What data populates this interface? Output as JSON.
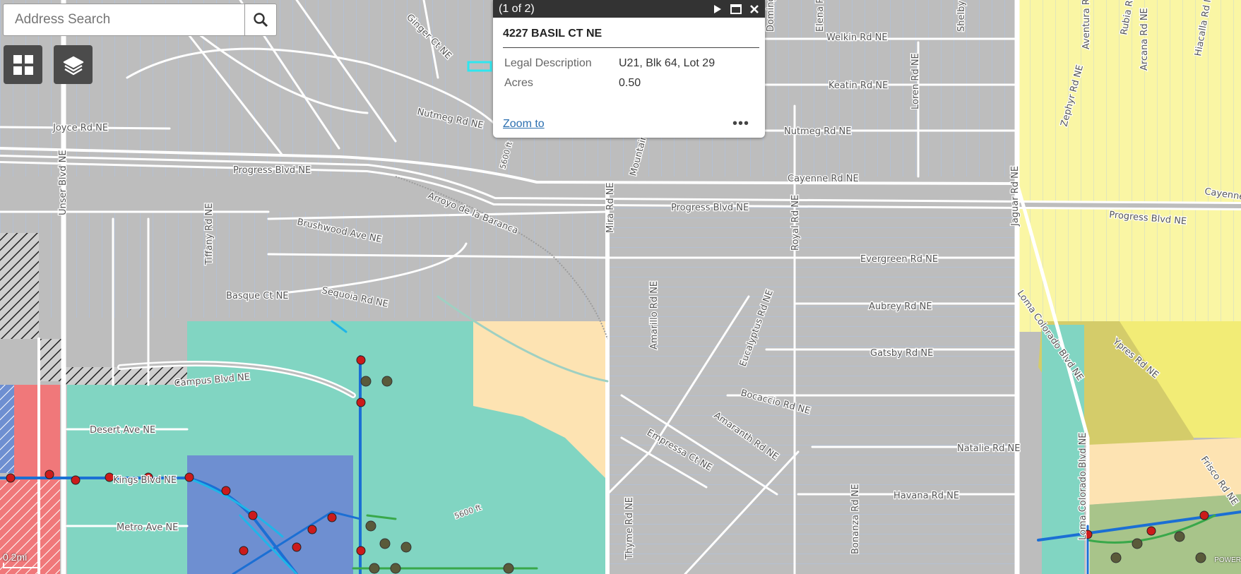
{
  "search": {
    "placeholder": "Address Search"
  },
  "tools": [
    {
      "name": "basemap-gallery",
      "icon": "grid-icon"
    },
    {
      "name": "layer-list",
      "icon": "layers-icon"
    }
  ],
  "popup": {
    "counter": "(1 of 2)",
    "title": "4227 BASIL CT NE",
    "fields": [
      {
        "label": "Legal Description",
        "value": "U21, Blk 64, Lot 29"
      },
      {
        "label": "Acres",
        "value": "0.50"
      }
    ],
    "zoom_link": "Zoom to",
    "more": "•••"
  },
  "scale": "0.2mi",
  "attribution": "POWER",
  "map": {
    "contours": [
      "5600 ft",
      "5600 ft"
    ],
    "water_label": "Arroyo de la Baranca",
    "streets": {
      "horizontal": [
        "Progress Blvd NE",
        "Progress Blvd NE",
        "Progress Blvd NE",
        "Joyce Rd NE",
        "Welkin Rd NE",
        "Keatin Rd NE",
        "Nutmeg Rd NE",
        "Nutmeg Rd NE",
        "Cayenne Rd NE",
        "Cayenne",
        "Evergreen Rd NE",
        "Aubrey Rd NE",
        "Gatsby Rd NE",
        "Bocaccio Rd NE",
        "Natalie Rd NE",
        "Havana Rd NE",
        "Brushwood Ave NE",
        "Sequoia Rd NE",
        "Basque Ct NE",
        "Campus Blvd NE",
        "Desert Ave NE",
        "Metro Ave NE",
        "Kings Blvd NE"
      ],
      "vertical": [
        "Unser Blvd NE",
        "Mira Rd NE",
        "Royal Rd NE",
        "Loren Rd NE",
        "Jaguar Rd NE",
        "Zephyr Rd NE",
        "Arcana Rd NE",
        "Hiacalla Rd NE",
        "Aventura Rd NE",
        "Amarillo Rd NE",
        "Mountain Rd NE",
        "Eucalyptus Rd NE",
        "Amaranth Rd NE",
        "Empressa Ct NE",
        "Loma Colorado Blvd NE",
        "Ypres Rd NE",
        "Loma Colorado Blvd NE",
        "Frisco Rd NE",
        "Bonanza Rd NE",
        "Tiffany Rd NE",
        "Ginger Ct NE",
        "Thyme Rd NE",
        "Domingo Rd NE",
        "Elena Rd NE",
        "Shelby Rd NE",
        "Rubia Rd NE"
      ]
    }
  },
  "colors": {
    "base": "#bdbdbd",
    "road": "#ffffff",
    "parcel_line": "#a9c3ee",
    "zone_green": "#81d5c2",
    "zone_blue": "#6e8fd1",
    "zone_tan": "#fde3b2",
    "zone_yellow": "#faf6a4",
    "zone_red": "#f0787a",
    "utility_blue": "#1b6fd4",
    "hydrant_red": "#cc1b1b"
  }
}
